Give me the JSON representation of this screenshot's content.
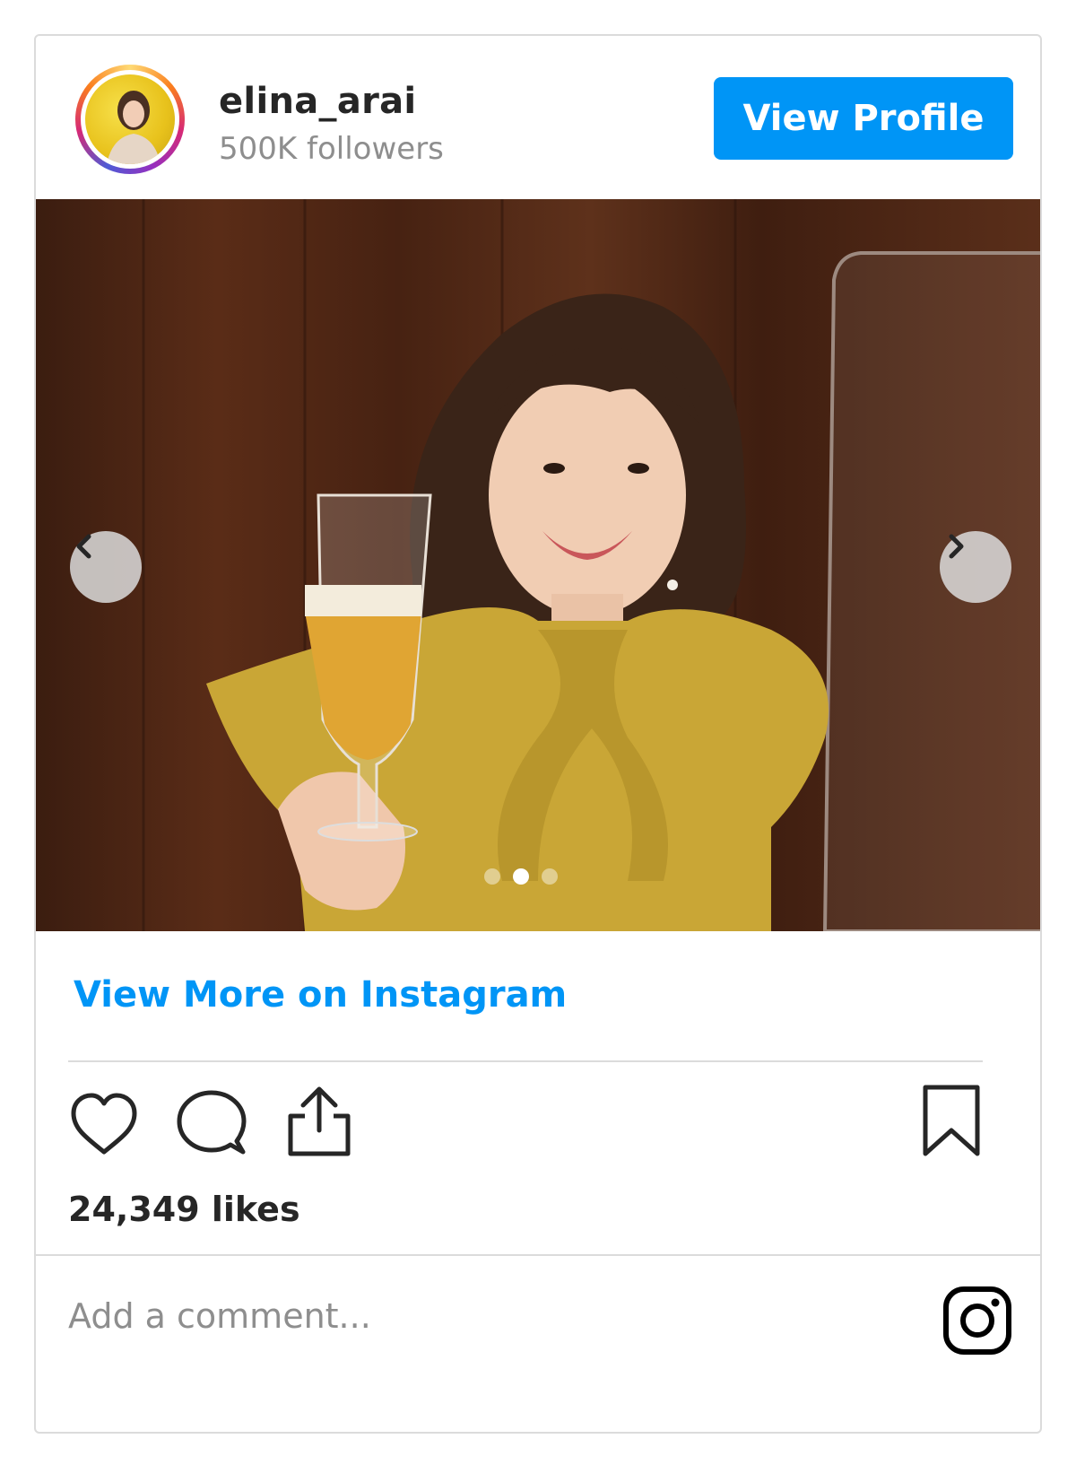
{
  "header": {
    "username": "elina_arai",
    "followers": "500K followers",
    "view_profile_label": "View Profile"
  },
  "post": {
    "image_description_icon": "carousel-photo",
    "carousel": {
      "dots": 3,
      "active_index": 1
    }
  },
  "links": {
    "view_more_label": "View More on Instagram"
  },
  "stats": {
    "likes": "24,349 likes"
  },
  "comment": {
    "placeholder": "Add a comment..."
  },
  "icons": {
    "like": "heart-icon",
    "comment": "comment-icon",
    "share": "share-icon",
    "save": "bookmark-icon",
    "brand": "instagram-icon",
    "prev": "chevron-left-icon",
    "next": "chevron-right-icon"
  },
  "colors": {
    "accent": "#0095f6",
    "text": "#262626",
    "muted": "#8e8e8e",
    "border": "#dbdbdb"
  }
}
